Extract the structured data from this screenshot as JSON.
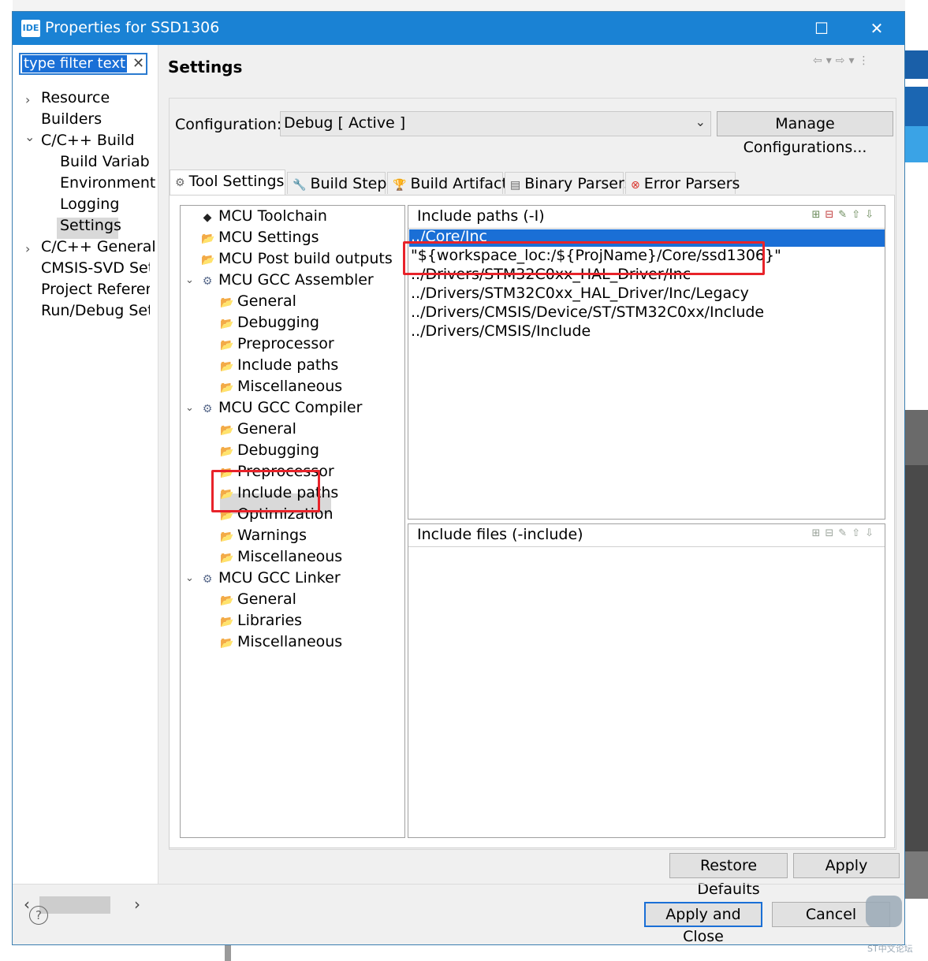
{
  "window": {
    "badge": "IDE",
    "title": "Properties for SSD1306",
    "maximize_glyph": "☐",
    "close_glyph": "✕"
  },
  "nav": {
    "filter_text": "type filter text",
    "items": [
      {
        "label": "Resource",
        "expander": "›"
      },
      {
        "label": "Builders"
      },
      {
        "label": "C/C++ Build",
        "expander": "⌄"
      },
      {
        "label": "Build Variable"
      },
      {
        "label": "Environment"
      },
      {
        "label": "Logging"
      },
      {
        "label": "Settings"
      },
      {
        "label": "C/C++ General",
        "expander": "›"
      },
      {
        "label": "CMSIS-SVD Sett"
      },
      {
        "label": "Project Referenc"
      },
      {
        "label": "Run/Debug Sett"
      }
    ],
    "scroll_left": "‹",
    "scroll_right": "›"
  },
  "header": {
    "title": "Settings"
  },
  "config": {
    "label": "Configuration:",
    "value": "Debug  [ Active ]",
    "manage_label": "Manage Configurations..."
  },
  "tabs": [
    {
      "label": "Tool Settings",
      "icon": "gear-icon"
    },
    {
      "label": "Build Steps",
      "icon": "wrench-icon"
    },
    {
      "label": "Build Artifact",
      "icon": "trophy-icon"
    },
    {
      "label": "Binary Parsers",
      "icon": "binary-icon"
    },
    {
      "label": "Error Parsers",
      "icon": "error-icon"
    }
  ],
  "tree": {
    "items": [
      {
        "label": "MCU Toolchain"
      },
      {
        "label": "MCU Settings"
      },
      {
        "label": "MCU Post build outputs"
      },
      {
        "label": "MCU GCC Assembler"
      },
      {
        "label": "General"
      },
      {
        "label": "Debugging"
      },
      {
        "label": "Preprocessor"
      },
      {
        "label": "Include paths"
      },
      {
        "label": "Miscellaneous"
      },
      {
        "label": "MCU GCC Compiler"
      },
      {
        "label": "General"
      },
      {
        "label": "Debugging"
      },
      {
        "label": "Preprocessor"
      },
      {
        "label": "Include paths"
      },
      {
        "label": "Optimization"
      },
      {
        "label": "Warnings"
      },
      {
        "label": "Miscellaneous"
      },
      {
        "label": "MCU GCC Linker"
      },
      {
        "label": "General"
      },
      {
        "label": "Libraries"
      },
      {
        "label": "Miscellaneous"
      }
    ]
  },
  "include_paths": {
    "title": "Include paths (-I)",
    "paths": [
      "../Core/Inc",
      "\"${workspace_loc:/${ProjName}/Core/ssd1306}\"",
      "../Drivers/STM32C0xx_HAL_Driver/Inc",
      "../Drivers/STM32C0xx_HAL_Driver/Inc/Legacy",
      "../Drivers/CMSIS/Device/ST/STM32C0xx/Include",
      "../Drivers/CMSIS/Include"
    ]
  },
  "include_files": {
    "title": "Include files (-include)"
  },
  "buttons": {
    "restore": "Restore Defaults",
    "apply": "Apply",
    "apply_close": "Apply and Close",
    "cancel": "Cancel",
    "help": "?"
  },
  "watermark": "ST中文论坛",
  "colors": {
    "titlebar": "#1a82d4",
    "selection": "#1a6fd6",
    "highlight_box": "#e8232a"
  }
}
